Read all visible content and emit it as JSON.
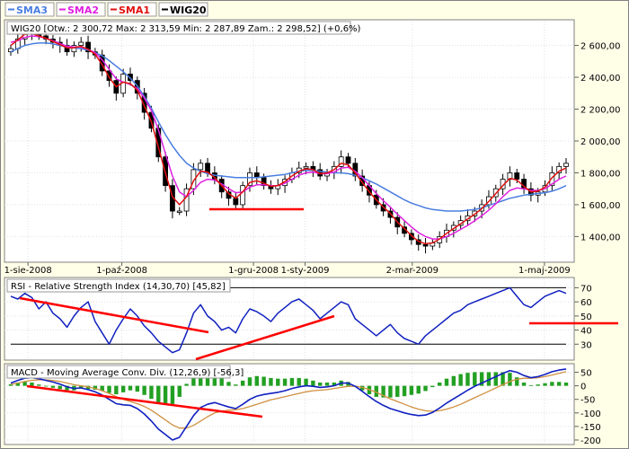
{
  "chart_data": {
    "type": "line",
    "legend": [
      {
        "name": "SMA3",
        "color": "#4a7ee0"
      },
      {
        "name": "SMA2",
        "color": "#e020e0"
      },
      {
        "name": "SMA1",
        "color": "#e01010"
      },
      {
        "name": "WIG20",
        "color": "#000000"
      }
    ],
    "price_panel": {
      "title": "WIG20 [Otw.: 2 300,72  Max: 2 313,59  Min: 2 287,89  Zam.: 2 298,52] (+0,6%)",
      "ylim": [
        1250,
        2750
      ],
      "yticks": [
        1400,
        1600,
        1800,
        2000,
        2200,
        2400,
        2600
      ],
      "ytick_labels": [
        "1 400,00",
        "1 600,00",
        "1 800,00",
        "2 000,00",
        "2 200,00",
        "2 400,00",
        "2 600,00"
      ],
      "x_labels": [
        {
          "text": "1-sie-2008",
          "t": 0.031
        },
        {
          "text": "1-paź-2008",
          "t": 0.2
        },
        {
          "text": "1-gru-2008",
          "t": 0.437
        },
        {
          "text": "1-sty-2009",
          "t": 0.53
        },
        {
          "text": "2-mar-2009",
          "t": 0.723
        },
        {
          "text": "1-maj-2009",
          "t": 0.961
        }
      ],
      "close": [
        2580,
        2640,
        2700,
        2680,
        2660,
        2640,
        2620,
        2600,
        2560,
        2600,
        2620,
        2560,
        2540,
        2440,
        2380,
        2300,
        2420,
        2380,
        2300,
        2180,
        2080,
        1900,
        1720,
        1560,
        1560,
        1700,
        1820,
        1860,
        1800,
        1760,
        1680,
        1640,
        1600,
        1720,
        1800,
        1770,
        1720,
        1700,
        1720,
        1760,
        1800,
        1830,
        1840,
        1820,
        1780,
        1800,
        1840,
        1900,
        1860,
        1780,
        1720,
        1660,
        1600,
        1560,
        1520,
        1460,
        1420,
        1380,
        1350,
        1340,
        1360,
        1400,
        1440,
        1470,
        1500,
        1530,
        1560,
        1600,
        1650,
        1700,
        1760,
        1800,
        1760,
        1700,
        1660,
        1680,
        1720,
        1800,
        1840,
        1860
      ],
      "sma1": [
        2600,
        2635,
        2670,
        2675,
        2660,
        2645,
        2625,
        2605,
        2585,
        2585,
        2595,
        2575,
        2545,
        2480,
        2400,
        2340,
        2370,
        2360,
        2320,
        2220,
        2120,
        1960,
        1800,
        1650,
        1600,
        1650,
        1750,
        1810,
        1805,
        1770,
        1720,
        1670,
        1640,
        1680,
        1740,
        1750,
        1735,
        1715,
        1720,
        1745,
        1780,
        1810,
        1825,
        1820,
        1795,
        1800,
        1820,
        1860,
        1850,
        1800,
        1740,
        1680,
        1630,
        1585,
        1545,
        1490,
        1450,
        1405,
        1370,
        1355,
        1360,
        1385,
        1420,
        1450,
        1480,
        1510,
        1540,
        1575,
        1620,
        1670,
        1720,
        1765,
        1755,
        1715,
        1680,
        1685,
        1710,
        1770,
        1810,
        1830
      ],
      "sma2": [
        2620,
        2630,
        2650,
        2660,
        2655,
        2645,
        2630,
        2612,
        2595,
        2590,
        2590,
        2575,
        2555,
        2510,
        2450,
        2390,
        2370,
        2355,
        2330,
        2270,
        2190,
        2070,
        1920,
        1780,
        1680,
        1650,
        1690,
        1740,
        1760,
        1755,
        1730,
        1700,
        1675,
        1680,
        1710,
        1725,
        1725,
        1720,
        1720,
        1735,
        1760,
        1785,
        1800,
        1805,
        1795,
        1795,
        1805,
        1830,
        1835,
        1810,
        1770,
        1720,
        1670,
        1625,
        1585,
        1540,
        1500,
        1460,
        1425,
        1400,
        1385,
        1385,
        1400,
        1420,
        1445,
        1470,
        1500,
        1530,
        1565,
        1605,
        1650,
        1690,
        1705,
        1700,
        1690,
        1690,
        1700,
        1730,
        1760,
        1780
      ],
      "sma3": [
        2560,
        2580,
        2600,
        2610,
        2615,
        2615,
        2610,
        2600,
        2590,
        2585,
        2580,
        2570,
        2555,
        2535,
        2505,
        2470,
        2435,
        2395,
        2345,
        2280,
        2205,
        2120,
        2040,
        1970,
        1910,
        1860,
        1830,
        1810,
        1795,
        1785,
        1780,
        1775,
        1770,
        1770,
        1770,
        1770,
        1775,
        1780,
        1785,
        1790,
        1800,
        1810,
        1815,
        1815,
        1810,
        1805,
        1800,
        1800,
        1795,
        1785,
        1770,
        1750,
        1730,
        1705,
        1680,
        1655,
        1630,
        1610,
        1595,
        1580,
        1570,
        1565,
        1560,
        1560,
        1560,
        1565,
        1570,
        1580,
        1595,
        1610,
        1625,
        1640,
        1650,
        1660,
        1665,
        1670,
        1675,
        1685,
        1700,
        1720
      ]
    },
    "rsi_panel": {
      "title": "RSI - Relative Strength Index (14,30,70) [45,82]",
      "ylim": [
        20,
        76
      ],
      "yticks": [
        30,
        40,
        50,
        60,
        70
      ],
      "reference_lines": [
        30,
        70
      ],
      "values": [
        64,
        62,
        66,
        63,
        55,
        60,
        52,
        48,
        42,
        50,
        56,
        60,
        46,
        38,
        30,
        40,
        48,
        55,
        50,
        43,
        38,
        32,
        28,
        24,
        26,
        38,
        52,
        58,
        50,
        46,
        40,
        42,
        38,
        48,
        55,
        53,
        50,
        46,
        52,
        56,
        60,
        62,
        58,
        54,
        48,
        52,
        56,
        60,
        58,
        48,
        44,
        40,
        36,
        40,
        44,
        38,
        34,
        32,
        30,
        36,
        40,
        44,
        48,
        52,
        54,
        58,
        60,
        62,
        64,
        66,
        68,
        70,
        64,
        58,
        56,
        60,
        64,
        66,
        68,
        66
      ]
    },
    "macd_panel": {
      "title": "MACD - Moving Average Conv. Div. (12,26,9) [-56,3]",
      "ylim": [
        -210,
        75
      ],
      "yticks": [
        -200,
        -150,
        -100,
        -50,
        0,
        50
      ],
      "macd": [
        10,
        20,
        28,
        30,
        26,
        20,
        14,
        6,
        -4,
        -10,
        -8,
        -14,
        -22,
        -34,
        -50,
        -66,
        -70,
        -72,
        -84,
        -104,
        -130,
        -160,
        -180,
        -200,
        -190,
        -150,
        -110,
        -80,
        -68,
        -62,
        -70,
        -78,
        -84,
        -68,
        -50,
        -38,
        -32,
        -28,
        -24,
        -18,
        -10,
        -4,
        0,
        -2,
        -6,
        -4,
        0,
        10,
        10,
        -2,
        -20,
        -40,
        -58,
        -72,
        -84,
        -92,
        -100,
        -106,
        -110,
        -108,
        -98,
        -82,
        -64,
        -48,
        -32,
        -16,
        -2,
        10,
        22,
        34,
        46,
        56,
        50,
        38,
        30,
        34,
        42,
        52,
        58,
        62
      ],
      "signal": [
        5,
        10,
        16,
        20,
        22,
        22,
        20,
        16,
        10,
        4,
        0,
        -4,
        -10,
        -18,
        -28,
        -40,
        -50,
        -58,
        -66,
        -76,
        -90,
        -108,
        -126,
        -144,
        -156,
        -156,
        -146,
        -130,
        -114,
        -100,
        -94,
        -90,
        -88,
        -84,
        -76,
        -68,
        -60,
        -52,
        -46,
        -40,
        -34,
        -28,
        -22,
        -18,
        -16,
        -14,
        -10,
        -6,
        -2,
        -2,
        -6,
        -14,
        -24,
        -36,
        -48,
        -58,
        -68,
        -78,
        -86,
        -92,
        -94,
        -92,
        -86,
        -78,
        -68,
        -56,
        -44,
        -32,
        -20,
        -8,
        4,
        16,
        24,
        28,
        28,
        30,
        34,
        40,
        46,
        52
      ]
    }
  }
}
